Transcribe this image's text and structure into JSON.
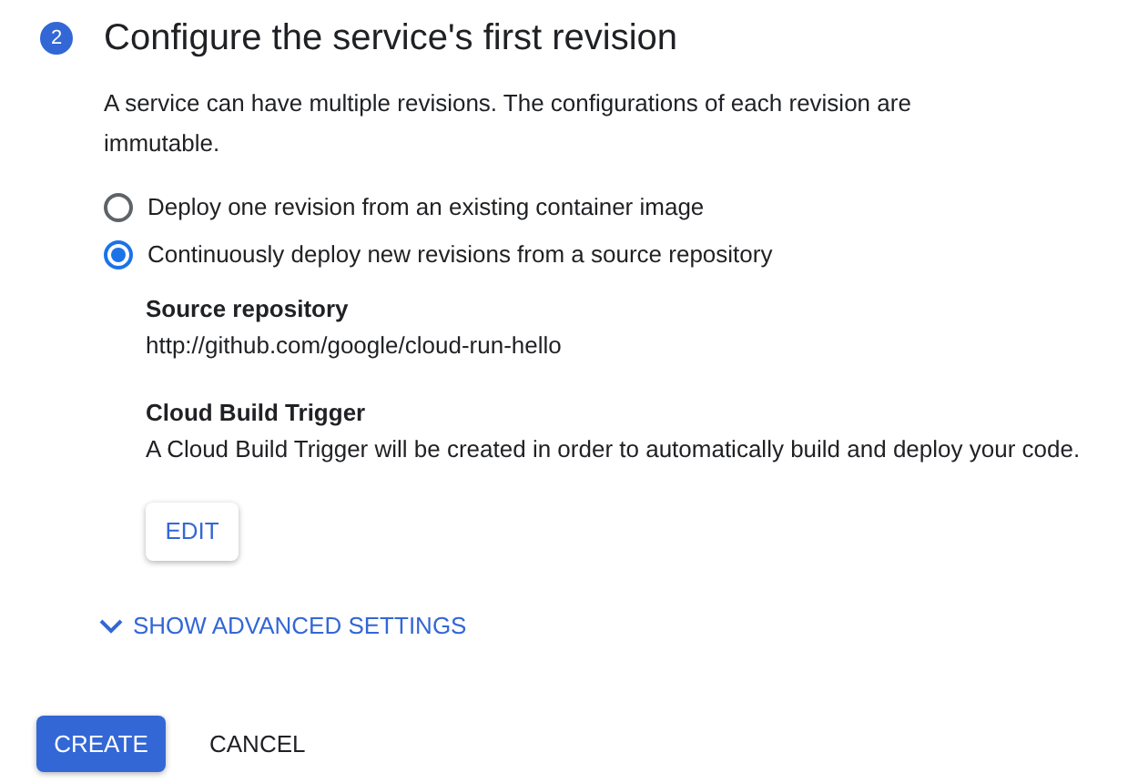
{
  "step": {
    "number": "2",
    "title": "Configure the service's first revision"
  },
  "description": "A service can have multiple revisions. The configurations of each revision are immutable.",
  "options": [
    {
      "label": "Deploy one revision from an existing container image",
      "selected": false
    },
    {
      "label": "Continuously deploy new revisions from a source repository",
      "selected": true
    }
  ],
  "source": {
    "heading": "Source repository",
    "value": "http://github.com/google/cloud-run-hello"
  },
  "trigger": {
    "heading": "Cloud Build Trigger",
    "text": "A Cloud Build Trigger will be created in order to automatically build and deploy your code.",
    "button": "EDIT"
  },
  "advanced": {
    "label": "SHOW ADVANCED SETTINGS",
    "expanded": false
  },
  "actions": {
    "primary": "CREATE",
    "secondary": "CANCEL"
  }
}
